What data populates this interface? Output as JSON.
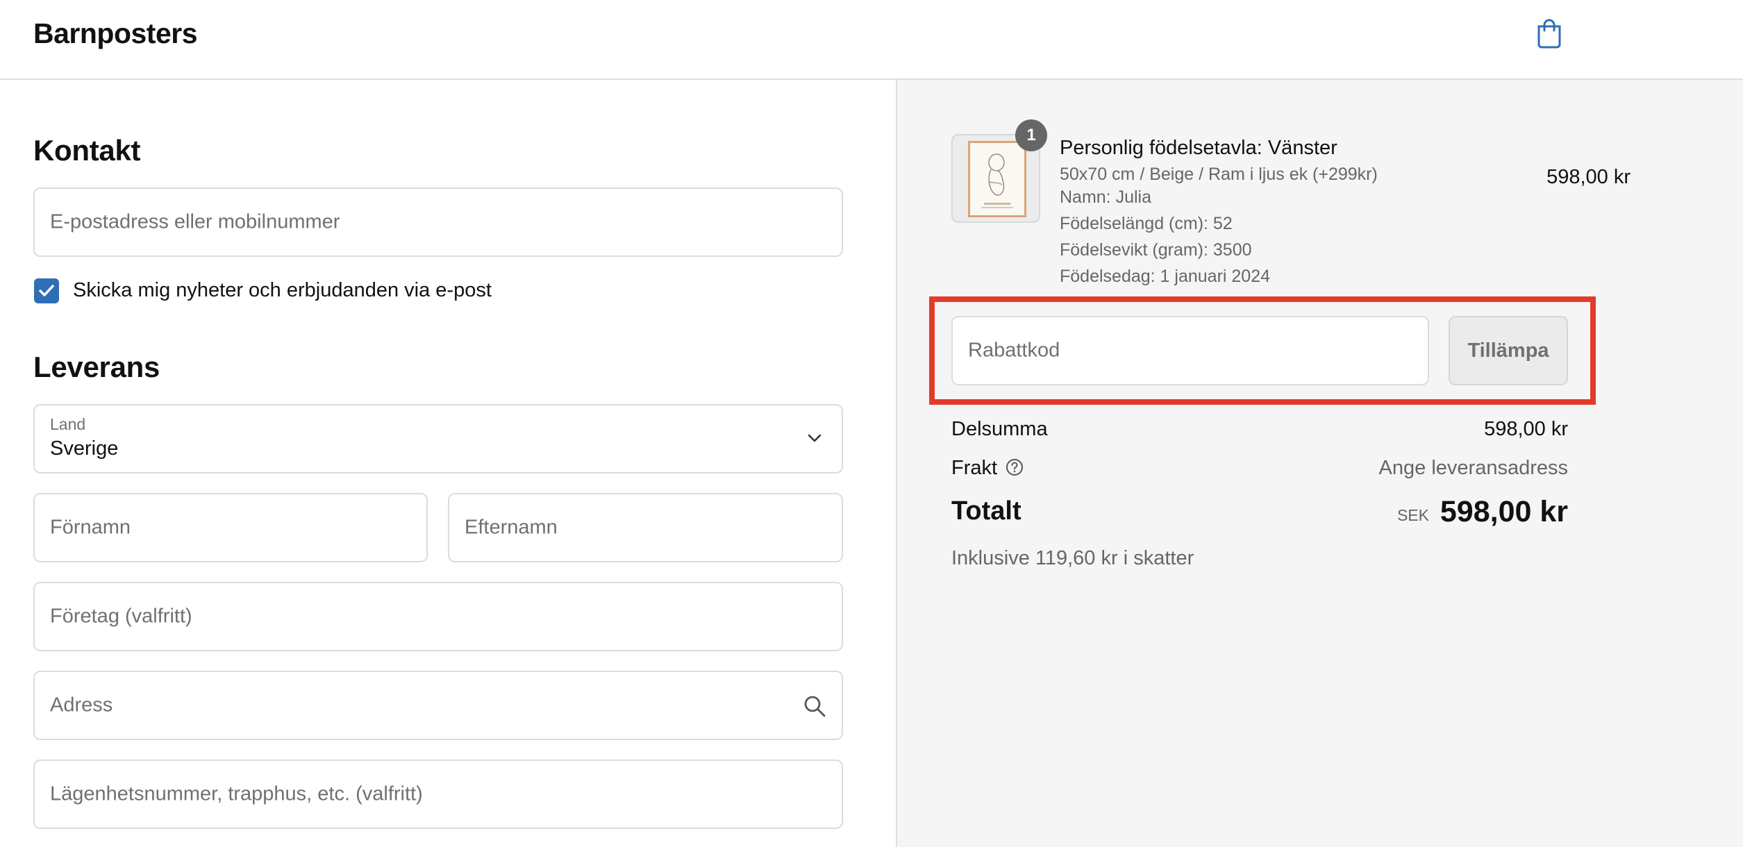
{
  "header": {
    "brand": "Barnposters",
    "cart_icon": "shopping-bag-icon"
  },
  "contact": {
    "title": "Kontakt",
    "email_placeholder": "E-postadress eller mobilnummer",
    "newsletter_label": "Skicka mig nyheter och erbjudanden via e-post",
    "newsletter_checked": true
  },
  "delivery": {
    "title": "Leverans",
    "country_label": "Land",
    "country_value": "Sverige",
    "first_name_placeholder": "Förnamn",
    "last_name_placeholder": "Efternamn",
    "company_placeholder": "Företag (valfritt)",
    "address_placeholder": "Adress",
    "apartment_placeholder": "Lägenhetsnummer, trapphus, etc. (valfritt)"
  },
  "summary": {
    "item": {
      "quantity": "1",
      "title": "Personlig födelsetavla: Vänster",
      "variant": "50x70 cm / Beige / Ram i ljus ek (+299kr)",
      "name": "Namn: Julia",
      "length": "Födelselängd (cm): 52",
      "weight": "Födelsevikt (gram): 3500",
      "birthdate": "Födelsedag: 1 januari 2024",
      "price": "598,00 kr"
    },
    "discount_placeholder": "Rabattkod",
    "apply_label": "Tillämpa",
    "subtotal_label": "Delsumma",
    "subtotal_value": "598,00 kr",
    "shipping_label": "Frakt",
    "shipping_value": "Ange leveransadress",
    "total_label": "Totalt",
    "total_currency": "SEK",
    "total_value": "598,00 kr",
    "tax_note": "Inklusive 119,60 kr i skatter"
  },
  "colors": {
    "accent": "#2f6eb5",
    "highlight": "#e13c2b",
    "panel_bg": "#f5f5f5"
  }
}
